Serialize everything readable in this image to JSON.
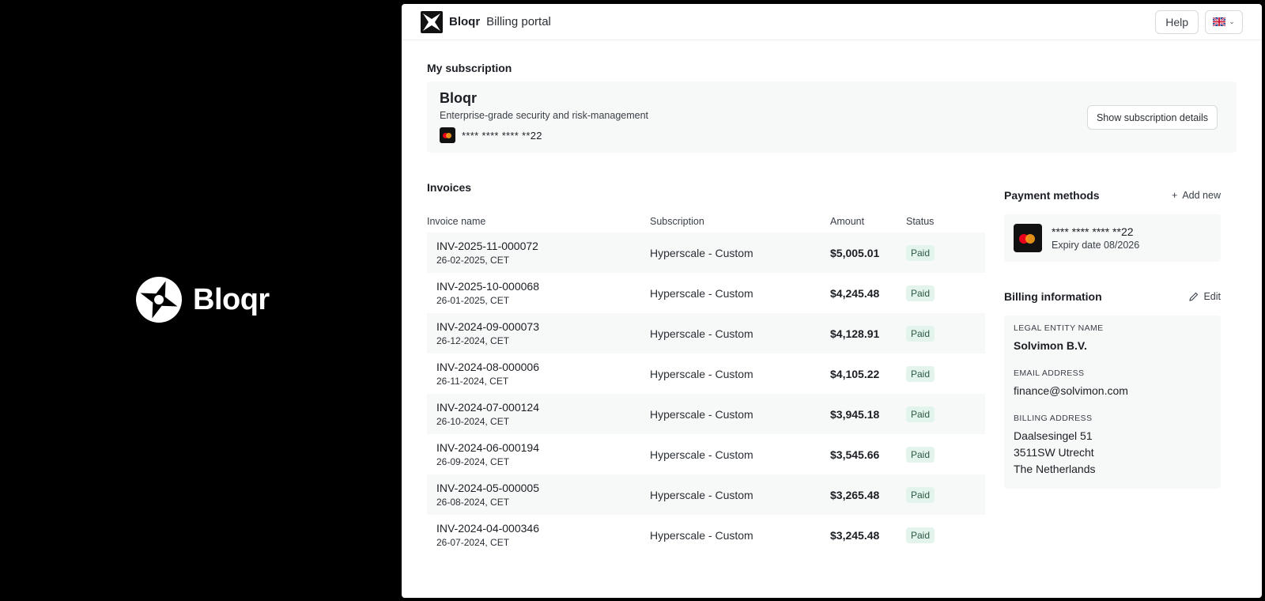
{
  "hero": {
    "brand": "Bloqr"
  },
  "topbar": {
    "app_name": "Bloqr",
    "section": "Billing portal",
    "help_label": "Help",
    "language_icon": "uk-flag-icon"
  },
  "subscription": {
    "heading": "My subscription",
    "product": "Bloqr",
    "description": "Enterprise-grade security and risk-management",
    "card_mask": "**** **** **** **22",
    "details_button": "Show subscription details"
  },
  "invoices": {
    "heading": "Invoices",
    "columns": [
      "Invoice name",
      "Subscription",
      "Amount",
      "Status"
    ],
    "rows": [
      {
        "id": "INV-2025-11-000072",
        "date": "26-02-2025, CET",
        "subscription": "Hyperscale - Custom",
        "amount": "$5,005.01",
        "status": "Paid"
      },
      {
        "id": "INV-2025-10-000068",
        "date": "26-01-2025, CET",
        "subscription": "Hyperscale - Custom",
        "amount": "$4,245.48",
        "status": "Paid"
      },
      {
        "id": "INV-2024-09-000073",
        "date": "26-12-2024, CET",
        "subscription": "Hyperscale - Custom",
        "amount": "$4,128.91",
        "status": "Paid"
      },
      {
        "id": "INV-2024-08-000006",
        "date": "26-11-2024, CET",
        "subscription": "Hyperscale - Custom",
        "amount": "$4,105.22",
        "status": "Paid"
      },
      {
        "id": "INV-2024-07-000124",
        "date": "26-10-2024, CET",
        "subscription": "Hyperscale - Custom",
        "amount": "$3,945.18",
        "status": "Paid"
      },
      {
        "id": "INV-2024-06-000194",
        "date": "26-09-2024, CET",
        "subscription": "Hyperscale - Custom",
        "amount": "$3,545.66",
        "status": "Paid"
      },
      {
        "id": "INV-2024-05-000005",
        "date": "26-08-2024, CET",
        "subscription": "Hyperscale - Custom",
        "amount": "$3,265.48",
        "status": "Paid"
      },
      {
        "id": "INV-2024-04-000346",
        "date": "26-07-2024, CET",
        "subscription": "Hyperscale - Custom",
        "amount": "$3,245.48",
        "status": "Paid"
      }
    ]
  },
  "payment_methods": {
    "heading": "Payment methods",
    "add_label": "Add new",
    "card_mask": "**** **** **** **22",
    "expiry": "Expiry date 08/2026"
  },
  "billing": {
    "heading": "Billing information",
    "edit_label": "Edit",
    "entity_label": "LEGAL ENTITY NAME",
    "entity_value": "Solvimon B.V.",
    "email_label": "EMAIL ADDRESS",
    "email_value": "finance@solvimon.com",
    "address_label": "BILLING ADDRESS",
    "address_lines": [
      "Daalsesingel 51",
      "3511SW Utrecht",
      "The Netherlands"
    ]
  },
  "colors": {
    "accent_black": "#000000",
    "row_bg": "#f7f8f8",
    "paid_badge": "#e3f4ec"
  }
}
